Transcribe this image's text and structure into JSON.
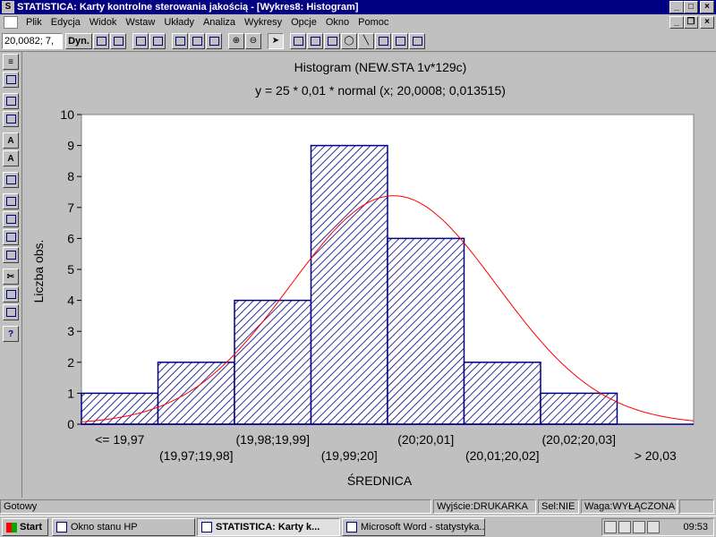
{
  "window": {
    "title": "STATISTICA: Karty kontrolne sterowania jakością - [Wykres8: Histogram]",
    "controls": {
      "minimize": "_",
      "maximize": "□",
      "close": "×"
    },
    "doc_controls": {
      "minimize": "_",
      "restore": "❐",
      "close": "×"
    }
  },
  "menu": [
    {
      "label": "Plik"
    },
    {
      "label": "Edycja"
    },
    {
      "label": "Widok"
    },
    {
      "label": "Wstaw"
    },
    {
      "label": "Układy"
    },
    {
      "label": "Analiza"
    },
    {
      "label": "Wykresy"
    },
    {
      "label": "Opcje"
    },
    {
      "label": "Okno"
    },
    {
      "label": "Pomoc"
    }
  ],
  "toolbar": {
    "coordinate": "20,0082; 7,",
    "dyn_label": "Dyn."
  },
  "chart_data": {
    "type": "bar",
    "title": "Histogram (NEW.STA 1v*129c)",
    "subtitle": "y = 25 * 0,01 * normal (x; 20,0008; 0,013515)",
    "xlabel": "ŚREDNICA",
    "ylabel": "Liczba obs.",
    "ylim": [
      0,
      10
    ],
    "yticks": [
      "0",
      "1",
      "2",
      "3",
      "4",
      "5",
      "6",
      "7",
      "8",
      "9",
      "10"
    ],
    "categories": [
      "<= 19,97",
      "(19,97;19,98]",
      "(19,98;19,99]",
      "(19,99;20]",
      "(20;20,01]",
      "(20,01;20,02]",
      "(20,02;20,03]",
      "> 20,03"
    ],
    "values": [
      1,
      2,
      4,
      9,
      6,
      2,
      1,
      0
    ],
    "fit_curve": {
      "function": "normal",
      "scale": 0.25,
      "mean": 20.0008,
      "sd": 0.013515,
      "color": "#ff0000"
    },
    "bar_fill": "hatched",
    "bar_color": "#000080",
    "grid": false,
    "legend": "none"
  },
  "status": {
    "ready": "Gotowy",
    "output": "Wyjście:DRUKARKA",
    "sel": "Sel:NIE",
    "weight": "Waga:WYŁĄCZONA"
  },
  "taskbar": {
    "start": "Start",
    "tasks": [
      {
        "label": "Okno stanu HP",
        "active": false
      },
      {
        "label": "STATISTICA: Karty k...",
        "active": true
      },
      {
        "label": "Microsoft Word - statystyka...",
        "active": false
      }
    ],
    "clock": "09:53"
  },
  "colors": {
    "titlebar": "#000080",
    "chrome": "#c0c0c0",
    "bar_stroke": "#000080",
    "curve": "#ff0000"
  }
}
